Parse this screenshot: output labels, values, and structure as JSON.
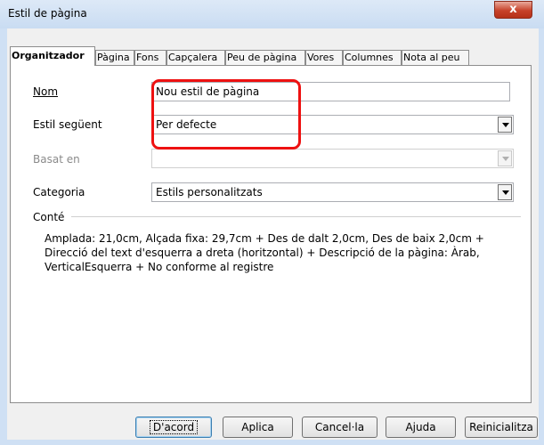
{
  "window": {
    "title": "Estil de pàgina",
    "close_glyph": "x"
  },
  "tabs": [
    {
      "label": "Organitzador",
      "active": true
    },
    {
      "label": "Pàgina"
    },
    {
      "label": "Fons"
    },
    {
      "label": "Capçalera"
    },
    {
      "label": "Peu de pàgina"
    },
    {
      "label": "Vores"
    },
    {
      "label": "Columnes"
    },
    {
      "label": "Nota al peu"
    }
  ],
  "form": {
    "nom": {
      "label": "Nom",
      "value": "Nou estil de pàgina"
    },
    "estil_seguent": {
      "label": "Estil següent",
      "value": "Per defecte"
    },
    "basat_en": {
      "label": "Basat en",
      "value": ""
    },
    "categoria": {
      "label": "Categoria",
      "value": "Estils personalitzats"
    }
  },
  "conte": {
    "label": "Conté",
    "text": "Amplada: 21,0cm, Alçada fixa: 29,7cm + Des de dalt 2,0cm, Des de baix 2,0cm + Direcció del text d'esquerra a dreta (horitzontal) + Descripció de la pàgina: Àrab, VerticalEsquerra + No conforme al registre"
  },
  "buttons": {
    "dacord": "D'acord",
    "aplica": "Aplica",
    "cancela": "Cancel·la",
    "ajuda": "Ajuda",
    "reinicialitza": "Reinicialitza"
  },
  "colors": {
    "highlight": "#e11111",
    "close_button": "#c7422a"
  }
}
